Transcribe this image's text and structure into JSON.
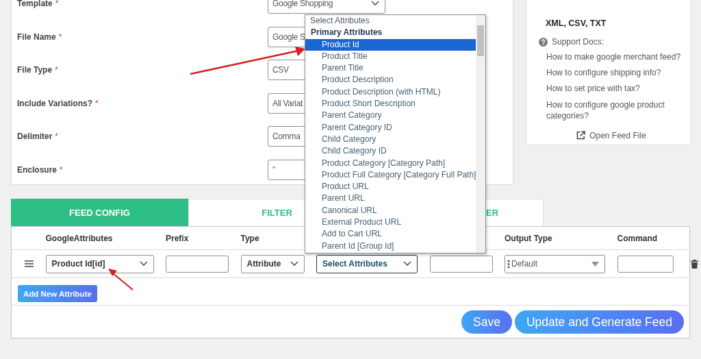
{
  "form": {
    "fields": [
      {
        "label": "Template",
        "marker": "*",
        "kind": "select",
        "value": "Google Shopping"
      },
      {
        "label": "File Name",
        "marker": "*",
        "kind": "input",
        "value": "Google S"
      },
      {
        "label": "File Type",
        "marker": "*",
        "kind": "input",
        "value": "CSV"
      },
      {
        "label": "Include Variations?",
        "marker": "*",
        "kind": "input",
        "value": "All Variat"
      },
      {
        "label": "Delimiter",
        "marker": "*",
        "kind": "input",
        "value": "Comma"
      },
      {
        "label": "Enclosure",
        "marker": "*",
        "kind": "input",
        "value": "\""
      }
    ]
  },
  "sidebar": {
    "formats": "XML, CSV, TXT",
    "docs_title": "Support Docs:",
    "links": [
      "How to make google merchant feed?",
      "How to configure shipping info?",
      "How to set price with tax?",
      "How to configure google product categories?"
    ],
    "open_feed": "Open Feed File"
  },
  "tabs": [
    {
      "label": "FEED CONFIG",
      "selected": true
    },
    {
      "label": "FILTER",
      "selected": false
    },
    {
      "label": "ER",
      "selected": false
    }
  ],
  "mapping": {
    "columns": [
      {
        "header": "GoogleAttributes"
      },
      {
        "header": "Prefix"
      },
      {
        "header": "Type"
      },
      {},
      {},
      {
        "header": "Output Type"
      },
      {
        "header": "Command"
      }
    ],
    "rows": [
      {
        "cells": [
          {
            "kind": "select",
            "value": "Product Id[id]",
            "focused": false
          },
          {
            "kind": "input"
          },
          {
            "kind": "select",
            "value": "Attribute",
            "focused": false
          },
          {
            "kind": "select",
            "value": "Select Attributes",
            "focused": true
          },
          {
            "kind": "input"
          },
          {
            "kind": "multiselect",
            "value": "Default"
          },
          {
            "kind": "input"
          }
        ]
      }
    ],
    "add_button": "Add New Attribute"
  },
  "dropdown": {
    "items": [
      {
        "kind": "placeholder",
        "label": "Select Attributes",
        "selected": false
      },
      {
        "kind": "group",
        "label": "Primary Attributes",
        "selected": false
      },
      {
        "kind": "option",
        "label": "Product Id",
        "selected": true
      },
      {
        "kind": "option",
        "label": "Product Title",
        "selected": false
      },
      {
        "kind": "option",
        "label": "Parent Title",
        "selected": false
      },
      {
        "kind": "option",
        "label": "Product Description",
        "selected": false
      },
      {
        "kind": "option",
        "label": "Product Description (with HTML)",
        "selected": false
      },
      {
        "kind": "option",
        "label": "Product Short Description",
        "selected": false
      },
      {
        "kind": "option",
        "label": "Parent Category",
        "selected": false
      },
      {
        "kind": "option",
        "label": "Parent Category ID",
        "selected": false
      },
      {
        "kind": "option",
        "label": "Child Category",
        "selected": false
      },
      {
        "kind": "option",
        "label": "Child Category ID",
        "selected": false
      },
      {
        "kind": "option",
        "label": "Product Category [Category Path]",
        "selected": false
      },
      {
        "kind": "option",
        "label": "Product Full Category [Category Full Path]",
        "selected": false
      },
      {
        "kind": "option",
        "label": "Product URL",
        "selected": false
      },
      {
        "kind": "option",
        "label": "Parent URL",
        "selected": false
      },
      {
        "kind": "option",
        "label": "Canonical URL",
        "selected": false
      },
      {
        "kind": "option",
        "label": "External Product URL",
        "selected": false
      },
      {
        "kind": "option",
        "label": "Add to Cart URL",
        "selected": false
      },
      {
        "kind": "option",
        "label": "Parent Id [Group Id]",
        "selected": false
      }
    ]
  },
  "actions": [
    "Save",
    "Update and Generate Feed"
  ]
}
